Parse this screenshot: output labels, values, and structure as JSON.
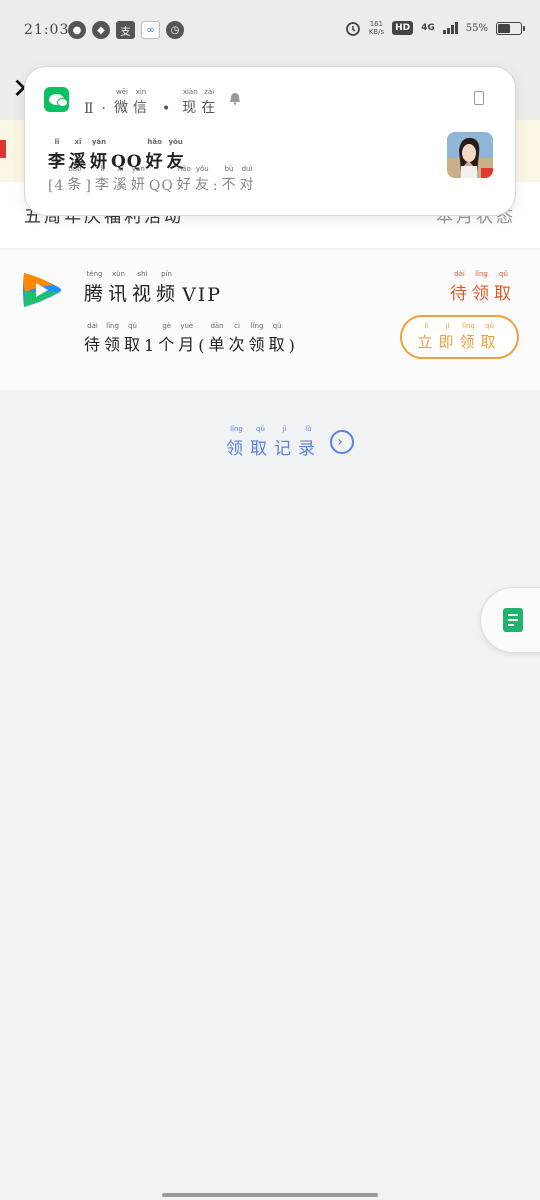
{
  "status_bar": {
    "time": "21:03",
    "speed_value": "161",
    "speed_unit": "KB/s",
    "hd": "HD",
    "network": "4G",
    "battery_text": "55%",
    "battery_level": 0.55
  },
  "background": {
    "activity_left": "五周年庆福利活动",
    "activity_right": "本月状态"
  },
  "vip_card": {
    "title": [
      [
        "腾",
        "téng"
      ],
      [
        "讯",
        "xùn"
      ],
      [
        "视",
        "shì"
      ],
      [
        "频",
        "pín"
      ]
    ],
    "title_suffix": "VIP",
    "status": [
      [
        "待",
        "dài"
      ],
      [
        "领",
        "lǐng"
      ],
      [
        "取",
        "qǔ"
      ]
    ],
    "subtitle": [
      [
        "待",
        "dài"
      ],
      [
        "领",
        "lǐng"
      ],
      [
        "取",
        "qǔ"
      ],
      [
        "1",
        ""
      ],
      [
        "个",
        "gè"
      ],
      [
        "月",
        "yuè"
      ],
      [
        "(",
        ""
      ],
      [
        "单",
        "dān"
      ],
      [
        "次",
        "cì"
      ],
      [
        "领",
        "lǐng"
      ],
      [
        "取",
        "qǔ"
      ],
      [
        ")",
        ""
      ]
    ],
    "button": [
      [
        "立",
        "lì"
      ],
      [
        "即",
        "jí"
      ],
      [
        "领",
        "lǐng"
      ],
      [
        "取",
        "qǔ"
      ]
    ],
    "brand_colors": {
      "orange": "#f0a038",
      "red": "#e35a2a",
      "blue": "#5b7fe0"
    }
  },
  "records_link": {
    "label": [
      [
        "领",
        "lǐng"
      ],
      [
        "取",
        "qǔ"
      ],
      [
        "记",
        "jì"
      ],
      [
        "录",
        "lù"
      ]
    ],
    "icon": "chevron-right-circle-icon"
  },
  "notification": {
    "app_prefix": "Ⅱ",
    "app_name": [
      [
        "微",
        "wēi"
      ],
      [
        "信",
        "xìn"
      ]
    ],
    "time": [
      [
        "现",
        "xiàn"
      ],
      [
        "在",
        "zài"
      ]
    ],
    "title": [
      [
        "李",
        "lǐ"
      ],
      [
        "溪",
        "xī"
      ],
      [
        "妍",
        "yán"
      ],
      [
        "QQ",
        ""
      ],
      [
        "好",
        "hǎo"
      ],
      [
        "友",
        "yǒu"
      ]
    ],
    "body": [
      [
        "[4",
        ""
      ],
      [
        "条",
        "tiáo"
      ],
      [
        "]",
        ""
      ],
      [
        "李",
        "lǐ"
      ],
      [
        "溪",
        "xī"
      ],
      [
        "妍",
        "yán"
      ],
      [
        "QQ",
        ""
      ],
      [
        "好",
        "hǎo"
      ],
      [
        "友",
        "yǒu"
      ],
      [
        ":",
        ""
      ],
      [
        "不",
        "bù"
      ],
      [
        "对",
        "duì"
      ]
    ],
    "icons": [
      "wechat-icon",
      "bell-icon",
      "sim-card-icon",
      "contact-avatar"
    ]
  },
  "floating_button": {
    "icon": "document-icon"
  }
}
